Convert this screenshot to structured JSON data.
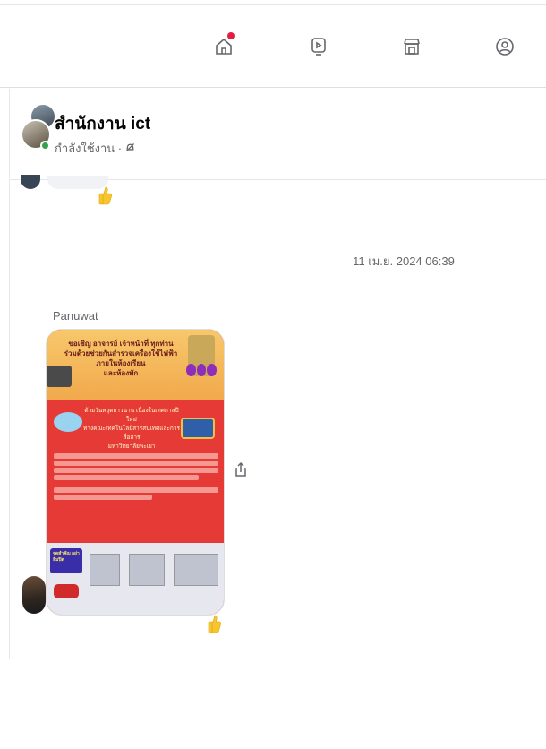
{
  "nav": {
    "items": [
      {
        "name": "home-icon",
        "active": true,
        "has_notification": true
      },
      {
        "name": "watch-icon",
        "active": false
      },
      {
        "name": "marketplace-icon",
        "active": false
      },
      {
        "name": "groups-icon",
        "active": false
      }
    ],
    "notification_color": "#e41e3f"
  },
  "chat": {
    "name": "สำนักงาน ict",
    "status": "กำลังใช้งาน ·",
    "online_color": "#31a24c"
  },
  "messages": {
    "timestamp": "11 เม.ย. 2024 06:39",
    "sender": "Panuwat",
    "reaction": "thumbs-up",
    "image": {
      "title_lines": [
        "ขอเชิญ อาจารย์ เจ้าหน้าที่ ทุกท่าน",
        "ร่วมด้วยช่วยกันสำรวจเครื่องใช้ไฟฟ้าภายในห้องเรียน",
        "และห้องพัก"
      ],
      "subtitle_lines": [
        "ด้วยวันหยุดยาวนาน เนื่องในเทศกาลปีใหม่",
        "ทางคณะเทคโนโลยีสารสนเทศและการสื่อสาร",
        "มหาวิทยาลัยพะเยา"
      ],
      "bottom_label": "จุดสำคัญ อย่าลืมปิด"
    }
  }
}
